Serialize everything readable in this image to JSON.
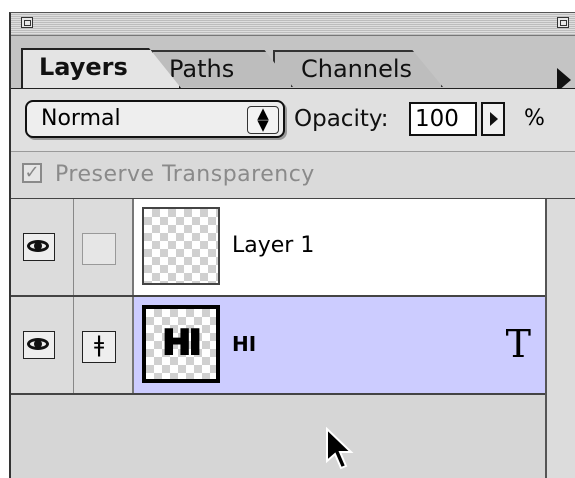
{
  "tabs": [
    {
      "label": "Layers",
      "active": true
    },
    {
      "label": "Paths",
      "active": false
    },
    {
      "label": "Channels",
      "active": false
    }
  ],
  "blend_mode": "Normal",
  "opacity": {
    "label": "Opacity:",
    "value": "100",
    "unit": "%"
  },
  "preserve_transparency": {
    "label": "Preserve Transparency",
    "checked": true,
    "enabled": false
  },
  "layers": [
    {
      "name": "Layer 1",
      "visible": true,
      "selected": false,
      "thumb_text": "",
      "type_icon": ""
    },
    {
      "name": "HI",
      "visible": true,
      "selected": true,
      "thumb_text": "HI",
      "type_icon": "T"
    }
  ],
  "colors": {
    "selected_row": "#ccccff",
    "layer_row": "#ffffff"
  },
  "icons": {
    "visibility": "eye-icon",
    "paint": "brush-icon",
    "type_layer": "type-layer-icon",
    "pointer": "arrow-cursor-icon"
  }
}
